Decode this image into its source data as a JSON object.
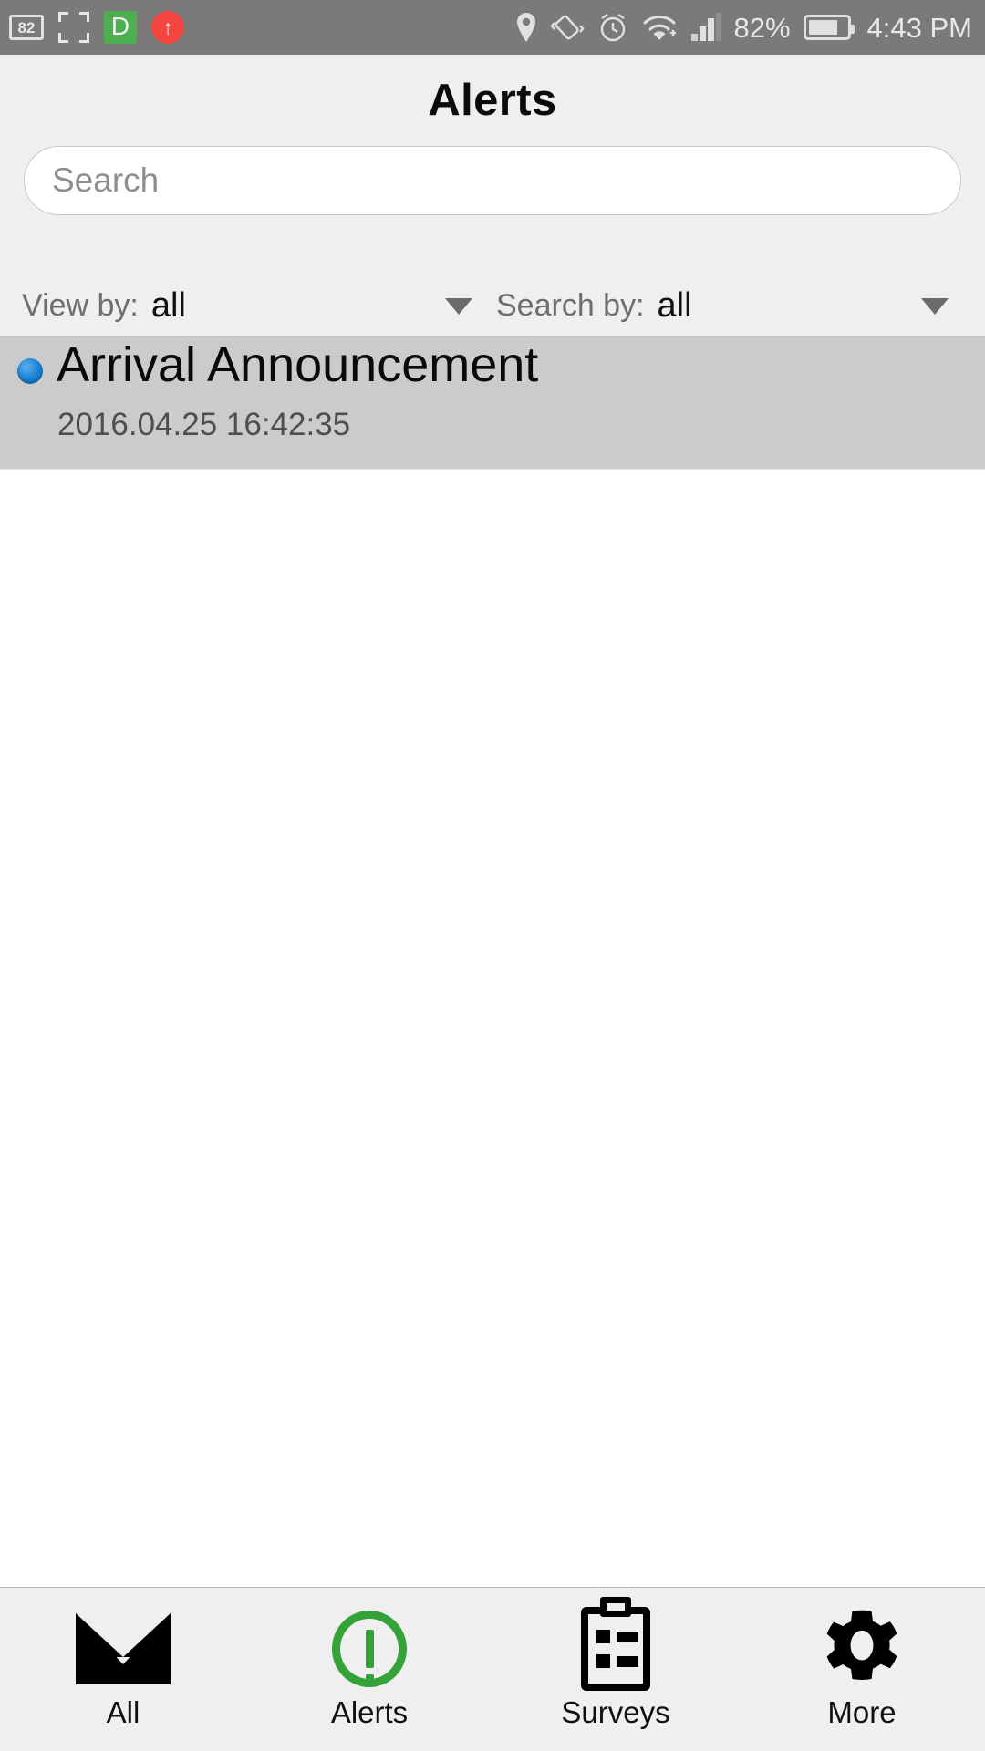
{
  "statusbar": {
    "left_icons": [
      {
        "name": "battery-saver-icon",
        "label": "82"
      },
      {
        "name": "screenshot-icon",
        "label": ""
      },
      {
        "name": "d-badge-icon",
        "label": "D"
      },
      {
        "name": "upload-arrow-icon",
        "label": "↑"
      }
    ],
    "right_icons": [
      {
        "name": "location-pin-icon"
      },
      {
        "name": "vibrate-icon"
      },
      {
        "name": "alarm-clock-icon"
      },
      {
        "name": "wifi-icon"
      },
      {
        "name": "cell-signal-icon"
      }
    ],
    "battery_percent": "82%",
    "time": "4:43 PM",
    "background_color": "#7a7a7a",
    "foreground_color": "#e6e6e6"
  },
  "header": {
    "title": "Alerts",
    "background_color": "#efeff0"
  },
  "search": {
    "value": "",
    "placeholder": "Search"
  },
  "filters": [
    {
      "label": "View by:",
      "value": "all",
      "caret": "▼"
    },
    {
      "label": "Search by:",
      "value": "all",
      "caret": "▼"
    }
  ],
  "list": {
    "rows": [
      {
        "title": "Arrival Announcement",
        "timestamp": "2016.04.25 16:42:35",
        "unread": true,
        "selected": true,
        "unread_dot_color": "#1b82d2",
        "row_background": "#cbcbcb"
      }
    ]
  },
  "tabbar": {
    "background_color": "#efeff0",
    "active_color": "#34a139",
    "items": [
      {
        "label": "All",
        "icon": "envelope-icon",
        "active": false
      },
      {
        "label": "Alerts",
        "icon": "alert-circle-icon",
        "active": true
      },
      {
        "label": "Surveys",
        "icon": "clipboard-icon",
        "active": false
      },
      {
        "label": "More",
        "icon": "gear-icon",
        "active": false
      }
    ]
  }
}
